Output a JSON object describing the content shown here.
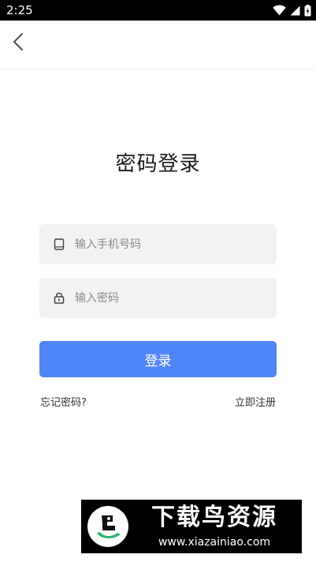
{
  "status_bar": {
    "time": "2:25",
    "icons": [
      "wifi-icon",
      "signal-icon",
      "battery-icon"
    ]
  },
  "header": {
    "back_icon": "chevron-left-icon"
  },
  "page": {
    "title": "密码登录"
  },
  "form": {
    "phone": {
      "icon": "phone-icon",
      "value": "",
      "placeholder": "输入手机号码"
    },
    "password": {
      "icon": "lock-icon",
      "value": "",
      "placeholder": "输入密码"
    },
    "login_label": "登录",
    "forgot_label": "忘记密码?",
    "register_label": "立即注册"
  },
  "watermark": {
    "title": "下载鸟资源",
    "url": "www.xiazainiao.com"
  },
  "colors": {
    "primary": "#4f86f7",
    "input_bg": "#f2f2f2",
    "text": "#1a1a1a",
    "placeholder": "#8a8a8a",
    "status_bar": "#000000"
  }
}
